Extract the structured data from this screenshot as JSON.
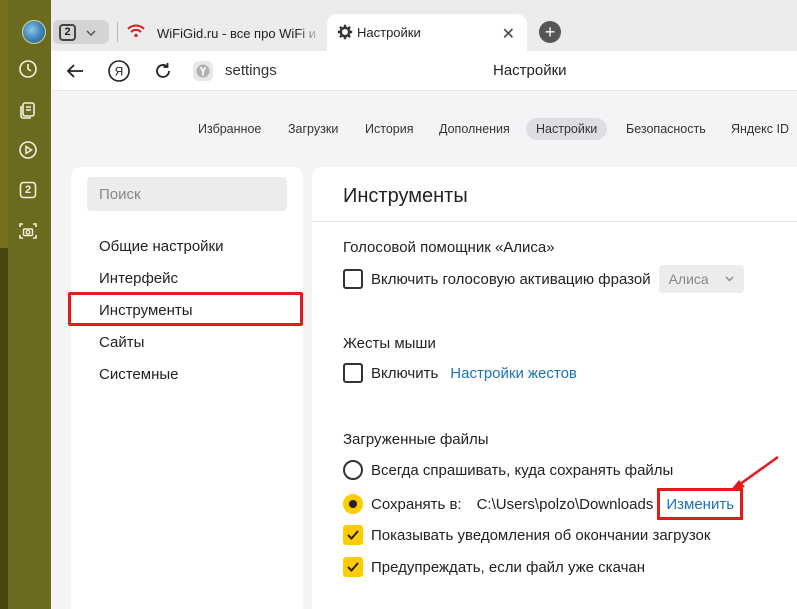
{
  "tabbar": {
    "tab_count": "2",
    "tabs": [
      {
        "title": "WiFiGid.ru - все про WiFi и"
      },
      {
        "title": "Настройки"
      }
    ]
  },
  "addressbar": {
    "url": "settings",
    "page_title": "Настройки"
  },
  "sidebar_icons": [
    "history-icon",
    "collections-icon",
    "video-icon",
    "tabs-counter-icon",
    "screenshot-icon"
  ],
  "sidebar_counter": "2",
  "settings_nav": {
    "items": [
      "Избранное",
      "Загрузки",
      "История",
      "Дополнения",
      "Настройки",
      "Безопасность",
      "Яндекс ID"
    ],
    "active": "Настройки"
  },
  "side_menu": {
    "search_placeholder": "Поиск",
    "items": [
      "Общие настройки",
      "Интерфейс",
      "Инструменты",
      "Сайты",
      "Системные"
    ],
    "active": "Инструменты"
  },
  "main": {
    "title": "Инструменты",
    "alice": {
      "title": "Голосовой помощник «Алиса»",
      "checkbox_label": "Включить голосовую активацию фразой",
      "checked": false,
      "phrase_value": "Алиса"
    },
    "gestures": {
      "title": "Жесты мыши",
      "checkbox_label": "Включить",
      "checked": false,
      "link": "Настройки жестов"
    },
    "downloads": {
      "title": "Загруженные файлы",
      "ask_label": "Всегда спрашивать, куда сохранять файлы",
      "save_label": "Сохранять в:",
      "save_path": "C:\\Users\\polzo\\Downloads",
      "change_link": "Изменить",
      "selected_option": "save_to",
      "notify_label": "Показывать уведомления об окончании загрузок",
      "notify_checked": true,
      "warn_label": "Предупреждать, если файл уже скачан",
      "warn_checked": true
    }
  },
  "colors": {
    "accent_yellow": "#ffcc00",
    "link_blue": "#1a73b8",
    "annotation_red": "#e21b1b",
    "sidebar_olive": "#6b6a1f"
  }
}
